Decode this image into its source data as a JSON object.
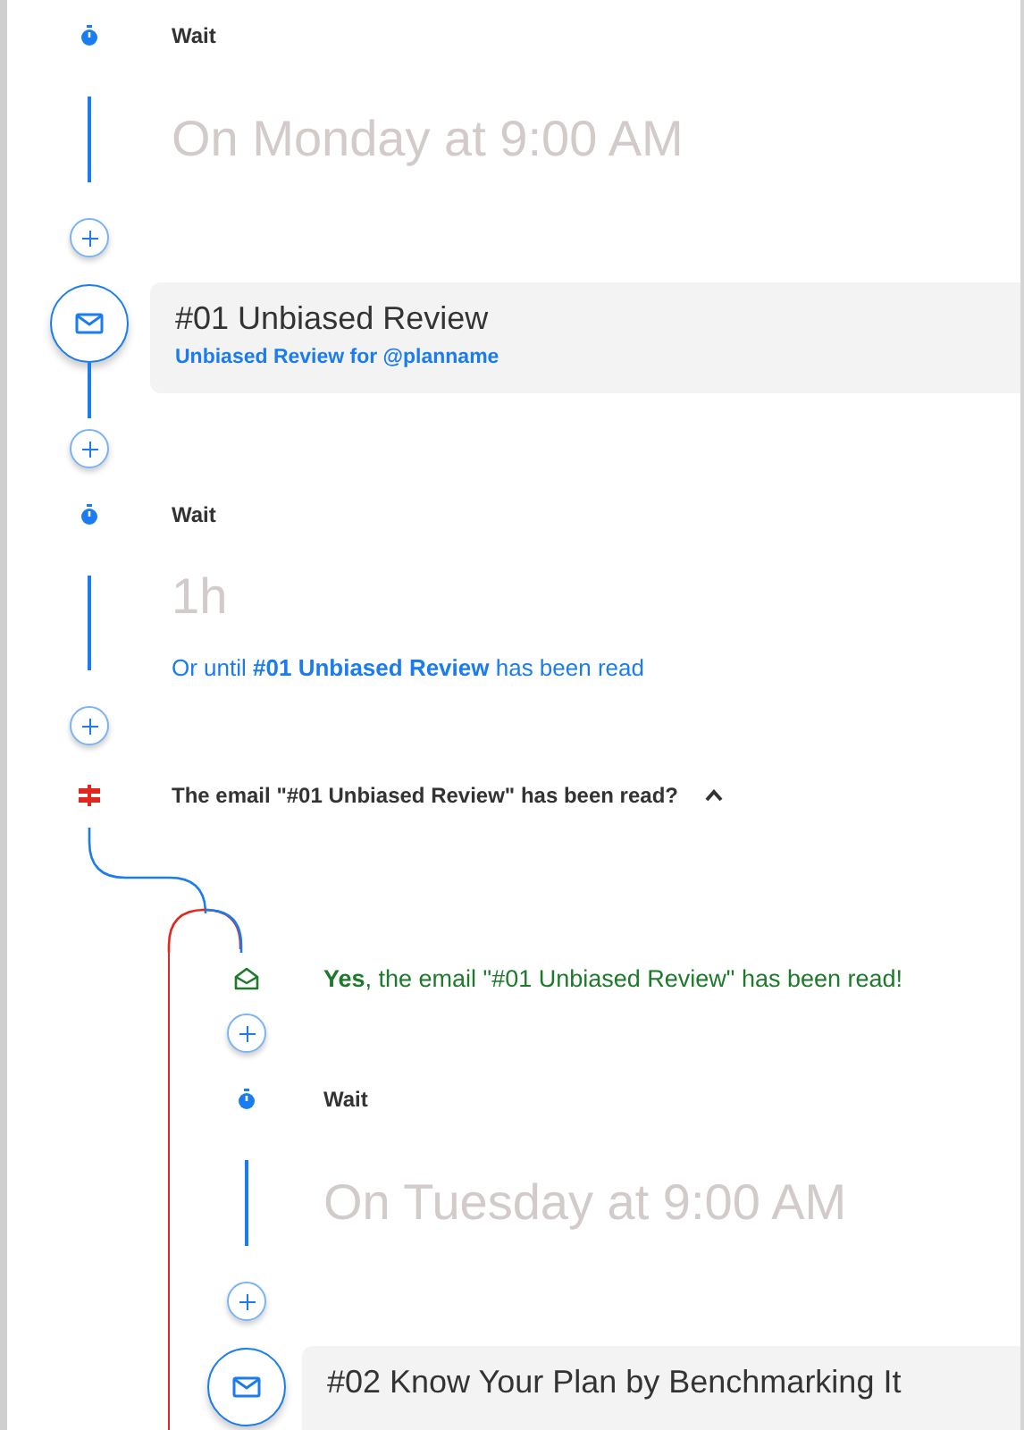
{
  "steps": [
    {
      "kind": "wait",
      "label": "Wait",
      "value": "On Monday at 9:00 AM"
    },
    {
      "kind": "add"
    },
    {
      "kind": "email",
      "title": "#01 Unbiased Review",
      "subtitle": "Unbiased Review for @planname"
    },
    {
      "kind": "add"
    },
    {
      "kind": "wait",
      "label": "Wait",
      "value": "1h",
      "until": "Or until **#01 Unbiased Review** has been read"
    },
    {
      "kind": "add"
    },
    {
      "kind": "condition",
      "label": "The email \"#01 Unbiased Review\" has been read?",
      "expanded": true
    },
    {
      "kind": "branch",
      "label": "**Yes**, the email \"#01 Unbiased Review\" has been read!",
      "children": [
        {
          "kind": "add"
        },
        {
          "kind": "wait",
          "label": "Wait",
          "value": "On Tuesday at 9:00 AM"
        },
        {
          "kind": "add"
        },
        {
          "kind": "email",
          "title": "#02 Know Your Plan by Benchmarking It"
        }
      ]
    }
  ]
}
